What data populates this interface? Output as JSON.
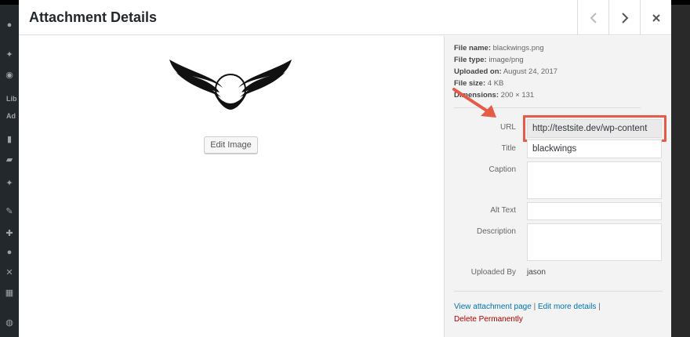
{
  "modal": {
    "title": "Attachment Details",
    "prev_icon": "chevron-left-icon",
    "next_icon": "chevron-right-icon",
    "close_icon": "close-icon"
  },
  "media": {
    "edit_image_label": "Edit Image"
  },
  "details": {
    "file_name_label": "File name:",
    "file_name": "blackwings.png",
    "file_type_label": "File type:",
    "file_type": "image/png",
    "uploaded_on_label": "Uploaded on:",
    "uploaded_on": "August 24, 2017",
    "file_size_label": "File size:",
    "file_size": "4 KB",
    "dimensions_label": "Dimensions:",
    "dimensions": "200 × 131"
  },
  "fields": {
    "url_label": "URL",
    "url_value": "http://testsite.dev/wp-content",
    "title_label": "Title",
    "title_value": "blackwings",
    "caption_label": "Caption",
    "caption_value": "",
    "alt_label": "Alt Text",
    "alt_value": "",
    "description_label": "Description",
    "description_value": "",
    "uploaded_by_label": "Uploaded By",
    "uploaded_by_value": "jason"
  },
  "actions": {
    "view_attachment": "View attachment page",
    "separator": "|",
    "edit_more": "Edit more details",
    "separator2": "|",
    "delete": "Delete Permanently"
  },
  "admin_sidebar": {
    "lib_text": "Lib",
    "add_text": "Ad"
  },
  "colors": {
    "highlight": "#e55b47",
    "link": "#0073aa",
    "delete": "#aa0000"
  }
}
